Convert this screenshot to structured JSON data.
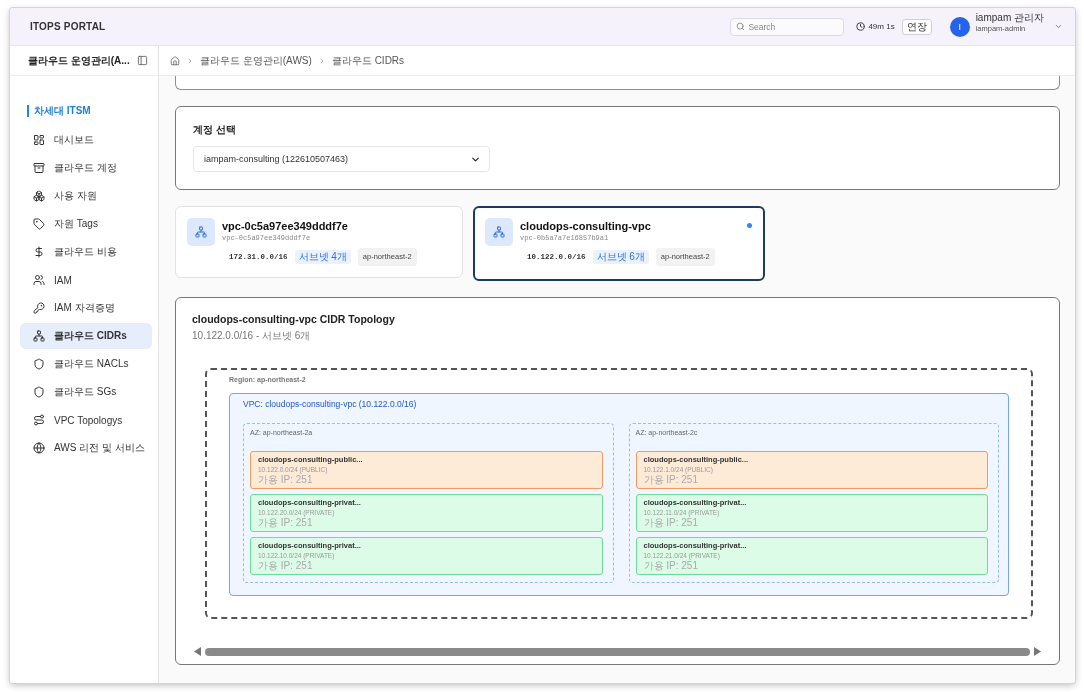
{
  "header": {
    "title": "ITOPS PORTAL",
    "search": {
      "placeholder": "Search"
    },
    "session_timer": "49m 1s",
    "extend_button": "연장",
    "user": {
      "avatar_initial": "I",
      "name": "iampam 관리자",
      "username": "iampam-admin"
    }
  },
  "sidebar": {
    "title": "클라우드 운영관리(A...",
    "section": "차세대 ITSM",
    "items": [
      {
        "label": "대시보드",
        "selected": false
      },
      {
        "label": "클라우드 계정",
        "selected": false
      },
      {
        "label": "사용 자원",
        "selected": false
      },
      {
        "label": "자원 Tags",
        "selected": false
      },
      {
        "label": "클라우드 비용",
        "selected": false
      },
      {
        "label": "IAM",
        "selected": false
      },
      {
        "label": "IAM 자격증명",
        "selected": false
      },
      {
        "label": "클라우드 CIDRs",
        "selected": true
      },
      {
        "label": "클라우드 NACLs",
        "selected": false
      },
      {
        "label": "클라우드 SGs",
        "selected": false
      },
      {
        "label": "VPC Topologys",
        "selected": false
      },
      {
        "label": "AWS 리전 및 서비스",
        "selected": false
      }
    ]
  },
  "breadcrumb": [
    "클라우드 운영관리(AWS)",
    "클라우드 CIDRs"
  ],
  "account_select": {
    "label": "계정 선택",
    "value": "iampam-consulting (122610507463)"
  },
  "vpcs": [
    {
      "name": "vpc-0c5a97ee349dddf7e",
      "id": "vpc-0c5a97ee349dddf7e",
      "cidr": "172.31.0.0/16",
      "subnets": "서브넷 4개",
      "region": "ap-northeast-2",
      "selected": false
    },
    {
      "name": "cloudops-consulting-vpc",
      "id": "vpc-0b5a7a7e16857b9a1",
      "cidr": "10.122.0.0/16",
      "subnets": "서브넷 6개",
      "region": "ap-northeast-2",
      "selected": true
    }
  ],
  "topology": {
    "title": "cloudops-consulting-vpc CIDR Topology",
    "subtitle": "10.122.0.0/16 - 서브넷 6개",
    "region": "Region: ap-northeast-2",
    "vpc": "VPC: cloudops-consulting-vpc (10.122.0.0/16)",
    "azs": [
      {
        "name": "AZ: ap-northeast-2a",
        "subnets": [
          {
            "kind": "public",
            "name": "cloudops-consulting-public...",
            "cidr": "10.122.0.0/24 (PUBLIC)",
            "available": "가용 IP: 251"
          },
          {
            "kind": "private",
            "name": "cloudops-consulting-privat...",
            "cidr": "10.122.20.0/24 (PRIVATE)",
            "available": "가용 IP: 251"
          },
          {
            "kind": "private",
            "name": "cloudops-consulting-privat...",
            "cidr": "10.122.10.0/24 (PRIVATE)",
            "available": "가용 IP: 251"
          }
        ]
      },
      {
        "name": "AZ: ap-northeast-2c",
        "subnets": [
          {
            "kind": "public",
            "name": "cloudops-consulting-public...",
            "cidr": "10.122.1.0/24 (PUBLIC)",
            "available": "가용 IP: 251"
          },
          {
            "kind": "private",
            "name": "cloudops-consulting-privat...",
            "cidr": "10.122.11.0/24 (PRIVATE)",
            "available": "가용 IP: 251"
          },
          {
            "kind": "private",
            "name": "cloudops-consulting-privat...",
            "cidr": "10.122.21.0/24 (PRIVATE)",
            "available": "가용 IP: 251"
          }
        ]
      }
    ]
  }
}
